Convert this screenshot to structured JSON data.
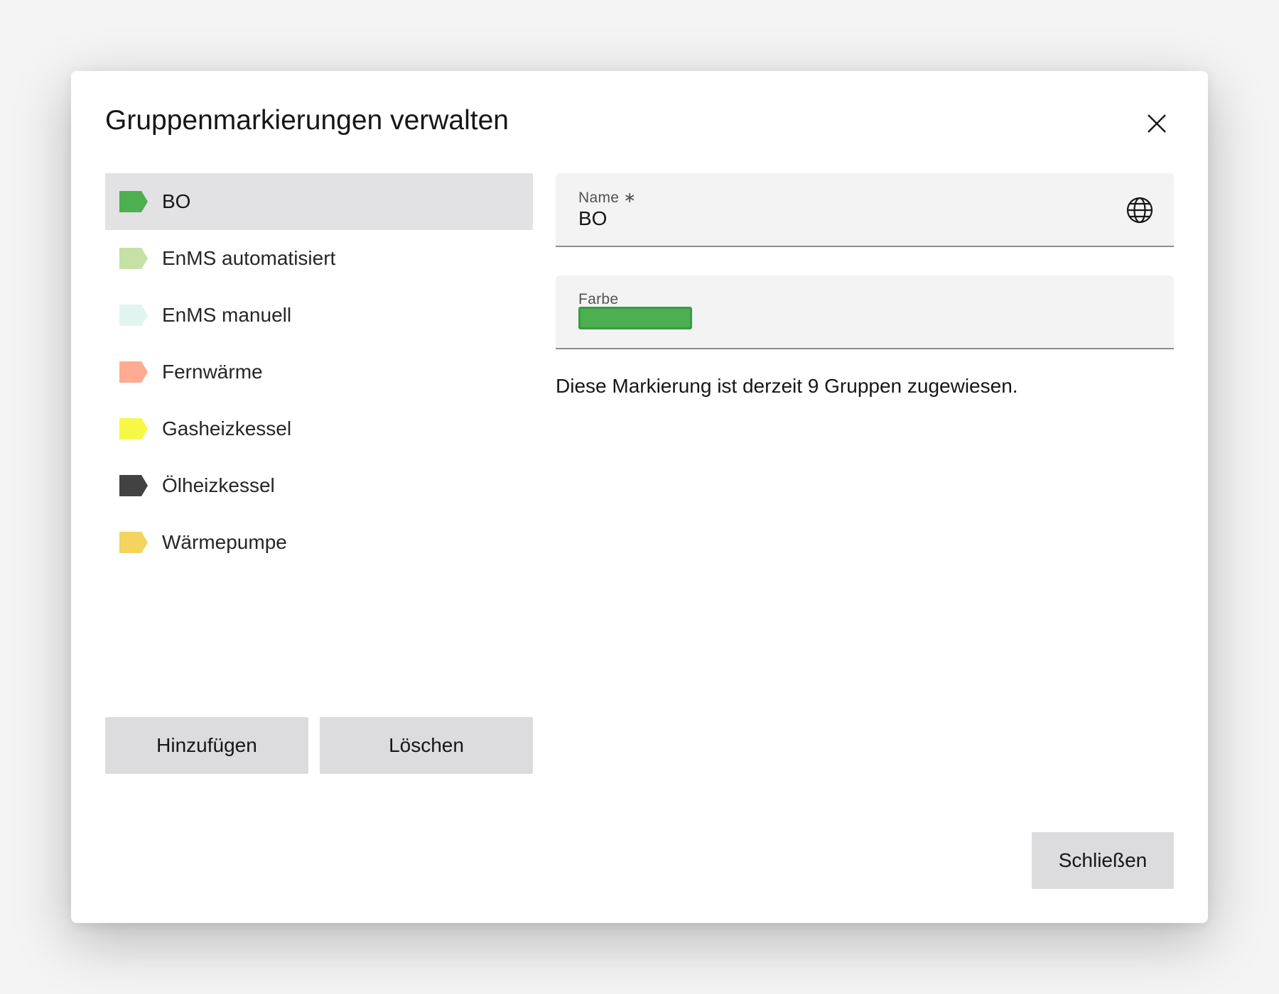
{
  "dialog": {
    "title": "Gruppenmarkierungen verwalten",
    "close_icon": "close-icon"
  },
  "tags": [
    {
      "label": "BO",
      "color": "#4caf50",
      "selected": true
    },
    {
      "label": "EnMS automatisiert",
      "color": "#c5e1a5",
      "selected": false
    },
    {
      "label": "EnMS manuell",
      "color": "#e0f5f0",
      "selected": false
    },
    {
      "label": "Fernwärme",
      "color": "#ffab91",
      "selected": false
    },
    {
      "label": "Gasheizkessel",
      "color": "#f7f745",
      "selected": false
    },
    {
      "label": "Ölheizkessel",
      "color": "#424242",
      "selected": false
    },
    {
      "label": "Wärmepumpe",
      "color": "#f4d35e",
      "selected": false
    }
  ],
  "form": {
    "name_label": "Name ∗",
    "name_value": "BO",
    "translate_icon": "globe-icon",
    "color_label": "Farbe",
    "color_value": "#4caf50",
    "info_text": "Diese Markierung ist derzeit 9 Gruppen zugewiesen."
  },
  "actions": {
    "add_label": "Hinzufügen",
    "delete_label": "Löschen",
    "close_label": "Schließen"
  }
}
